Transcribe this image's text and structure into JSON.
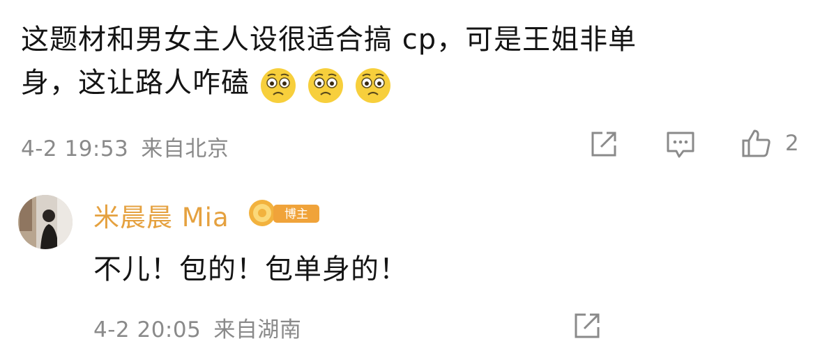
{
  "comment": {
    "text_line1": "这题材和男女主人设很适合搞 cp，可是王姐非单",
    "text_line2": "身，这让路人咋磕",
    "emojis": [
      "worried-face-icon",
      "worried-face-icon",
      "worried-face-icon"
    ],
    "time": "4-2 19:53",
    "location": "来自北京",
    "like_count": "2"
  },
  "reply": {
    "author": "米晨晨 Mia",
    "badge_label": "博主",
    "text": "不儿！包的！包单身的！",
    "time": "4-2 20:05",
    "location": "来自湖南"
  },
  "colors": {
    "name_color": "#e5a13f",
    "meta_color": "#8a8a8a",
    "badge_color": "#f0a33a"
  }
}
